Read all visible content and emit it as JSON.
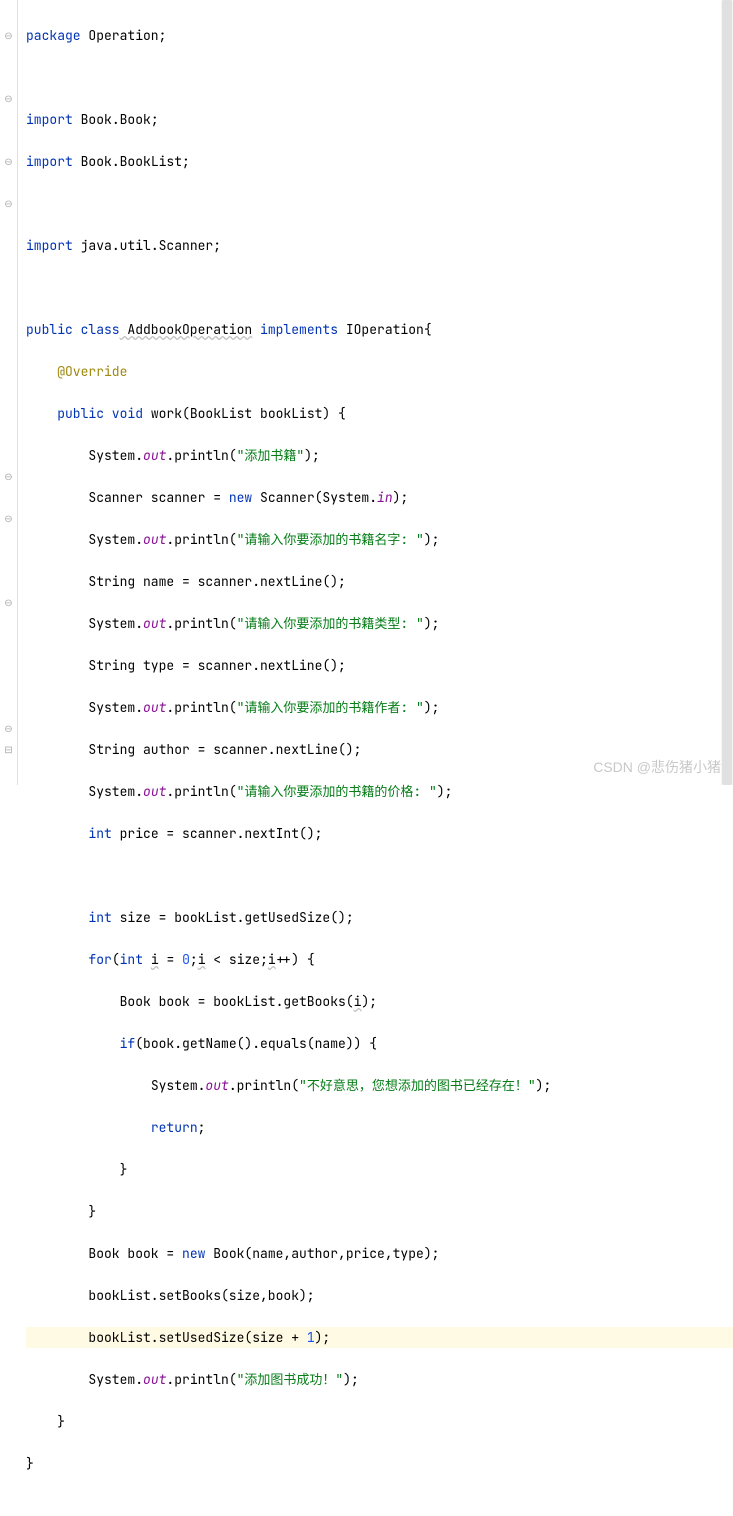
{
  "gutter": {
    "marks": [
      "",
      "⊖",
      "",
      "",
      "⊖",
      "",
      "",
      "⊖",
      "",
      "⊖",
      "",
      "",
      "",
      "",
      "",
      "",
      "",
      "",
      "",
      "",
      "",
      "",
      "⊖",
      "",
      "⊖",
      "",
      "",
      "",
      "⊖",
      "",
      "",
      "",
      "",
      "",
      "⊖",
      "⊟",
      ""
    ]
  },
  "code": {
    "l1": {
      "kw": "package",
      "txt": " Operation;"
    },
    "l2": "",
    "l3": {
      "kw": "import",
      "txt": " Book.Book;"
    },
    "l4": {
      "kw": "import",
      "txt": " Book.BookList;"
    },
    "l5": "",
    "l6": {
      "kw": "import",
      "txt": " java.util.Scanner;"
    },
    "l7": "",
    "l8": {
      "kw1": "public class",
      "cls": " AddbookOperation",
      "kw2": " implements",
      "txt": " IOperation{"
    },
    "l9": {
      "ann": "@Override",
      "indent": "    "
    },
    "l10": {
      "indent": "    ",
      "kw1": "public void",
      "method": " work",
      "txt1": "(BookList bookList) {"
    },
    "l11": {
      "indent": "        ",
      "txt1": "System.",
      "fld": "out",
      "txt2": ".println(",
      "str": "\"添加书籍\"",
      "txt3": ");"
    },
    "l12": {
      "indent": "        ",
      "txt1": "Scanner scanner = ",
      "kw": "new",
      "txt2": " Scanner(System.",
      "fld": "in",
      "txt3": ");"
    },
    "l13": {
      "indent": "        ",
      "txt1": "System.",
      "fld": "out",
      "txt2": ".println(",
      "str": "\"请输入你要添加的书籍名字: \"",
      "txt3": ");"
    },
    "l14": {
      "indent": "        ",
      "txt1": "String name = scanner.nextLine();"
    },
    "l15": {
      "indent": "        ",
      "txt1": "System.",
      "fld": "out",
      "txt2": ".println(",
      "str": "\"请输入你要添加的书籍类型: \"",
      "txt3": ");"
    },
    "l16": {
      "indent": "        ",
      "txt1": "String type = scanner.nextLine();"
    },
    "l17": {
      "indent": "        ",
      "txt1": "System.",
      "fld": "out",
      "txt2": ".println(",
      "str": "\"请输入你要添加的书籍作者: \"",
      "txt3": ");"
    },
    "l18": {
      "indent": "        ",
      "txt1": "String author = scanner.nextLine();"
    },
    "l19": {
      "indent": "        ",
      "txt1": "System.",
      "fld": "out",
      "txt2": ".println(",
      "str": "\"请输入你要添加的书籍的价格: \"",
      "txt3": ");"
    },
    "l20": {
      "indent": "        ",
      "kw": "int",
      "txt1": " price = scanner.nextInt();"
    },
    "l21": "",
    "l22": {
      "indent": "        ",
      "kw": "int",
      "txt1": " size = bookList.getUsedSize();"
    },
    "l23": {
      "indent": "        ",
      "kw1": "for",
      "txt1": "(",
      "kw2": "int",
      "txt2": " ",
      "var": "i",
      "txt3": " = ",
      "num1": "0",
      "txt4": ";",
      "var2": "i",
      "txt5": " < size;",
      "var3": "i",
      "txt6": "++) {"
    },
    "l24": {
      "indent": "            ",
      "txt1": "Book book = bookList.getBooks(",
      "var": "i",
      "txt2": ");"
    },
    "l25": {
      "indent": "            ",
      "kw": "if",
      "txt1": "(book.getName().equals(name)) {"
    },
    "l26": {
      "indent": "                ",
      "txt1": "System.",
      "fld": "out",
      "txt2": ".println(",
      "str": "\"不好意思，您想添加的图书已经存在！\"",
      "txt3": ");"
    },
    "l27": {
      "indent": "                ",
      "kw": "return",
      "txt1": ";"
    },
    "l28": {
      "indent": "            ",
      "txt1": "}"
    },
    "l29": {
      "indent": "        ",
      "txt1": "}"
    },
    "l30": {
      "indent": "        ",
      "txt1": "Book book = ",
      "kw": "new",
      "txt2": " Book(name,author,price,type);"
    },
    "l31": {
      "indent": "        ",
      "txt1": "bookList.setBooks(size,book);"
    },
    "l32": {
      "indent": "        ",
      "txt1": "bookList.setUsedSize(size + ",
      "num": "1",
      "txt2": ");"
    },
    "l33": {
      "indent": "        ",
      "txt1": "System.",
      "fld": "out",
      "txt2": ".println(",
      "str": "\"添加图书成功！\"",
      "txt3": ");"
    },
    "l34": {
      "indent": "    ",
      "txt1": "}"
    },
    "l35": {
      "txt1": "}"
    }
  },
  "watermark": "CSDN @悲伤猪小猪"
}
